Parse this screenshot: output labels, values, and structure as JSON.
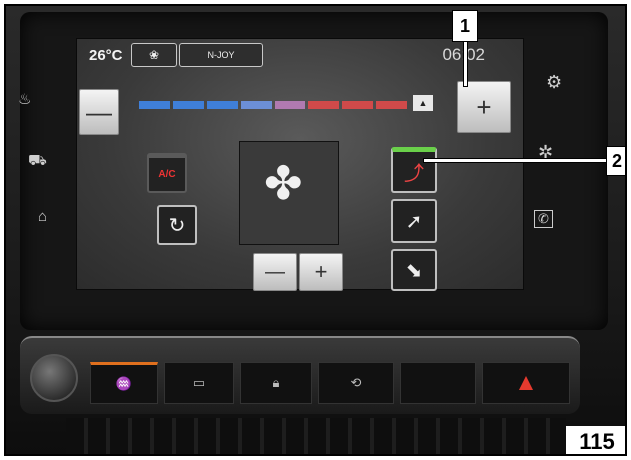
{
  "screen": {
    "temperature": "26°C",
    "tab_radio": "N-JOY",
    "clock": "06:02",
    "minus_label": "—",
    "plus_label": "+",
    "ac_label": "A/C",
    "fan_minus": "—",
    "fan_plus": "+"
  },
  "temperature_bar": {
    "segment_colors": [
      "#3f7fd8",
      "#3f7fd8",
      "#3f7fd8",
      "#6c8fd6",
      "#b07ab0",
      "#d04a4a",
      "#d04a4a",
      "#d04a4a"
    ]
  },
  "left_side_icons": [
    "rear-defrost-icon",
    "car-icon",
    "seat-icon"
  ],
  "right_side_icons": [
    "settings-gears-icon",
    "climate-person-icon",
    "phone-icon"
  ],
  "console_buttons": [
    "front-defrost-icon",
    "rear-window-defrost-icon",
    "lock-icon",
    "recirculation-icon",
    "blank",
    "hazard-icon"
  ],
  "callouts": {
    "one": "1",
    "two": "2",
    "figure_number": "115"
  }
}
